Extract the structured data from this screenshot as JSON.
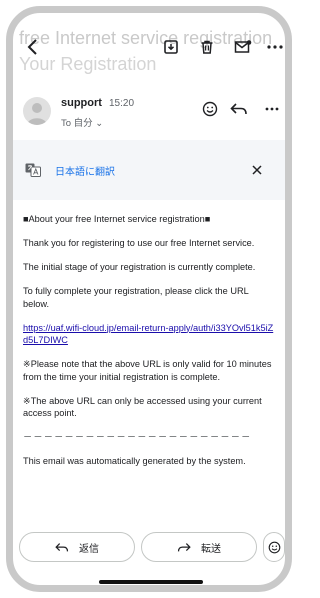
{
  "appbar": {
    "subject_line1": "free Internet service registration",
    "subject_line2": "Your Registration"
  },
  "sender": {
    "name": "support",
    "time": "15:20",
    "to_line": "To 自分 ⌄"
  },
  "translate_banner": {
    "label": "日本語に翻訳"
  },
  "email_body": {
    "heading": "■About your free Internet service registration■",
    "para1": "Thank you for registering to use our free Internet service.",
    "para2": "The initial stage of your registration is currently complete.",
    "para3": "To fully complete your registration, please click the URL below.",
    "link": "https://uaf.wifi-cloud.jp/email-return-apply/auth/i33YOvl51k5iZd5L7DIWC",
    "para4": "※Please note that the above URL is only valid for 10 minutes from the time your initial registration is complete.",
    "para5": "※The above URL can only be accessed using your current access point.",
    "divider": "－－－－－－－－－－－－－－－－－－－－－－",
    "footer": "This email was automatically generated by the system."
  },
  "actions": {
    "reply_label": "返信",
    "forward_label": "転送"
  },
  "colors": {
    "link": "#1a0dab",
    "translate_link": "#1a73e8",
    "banner_bg": "#f4f6f9"
  }
}
